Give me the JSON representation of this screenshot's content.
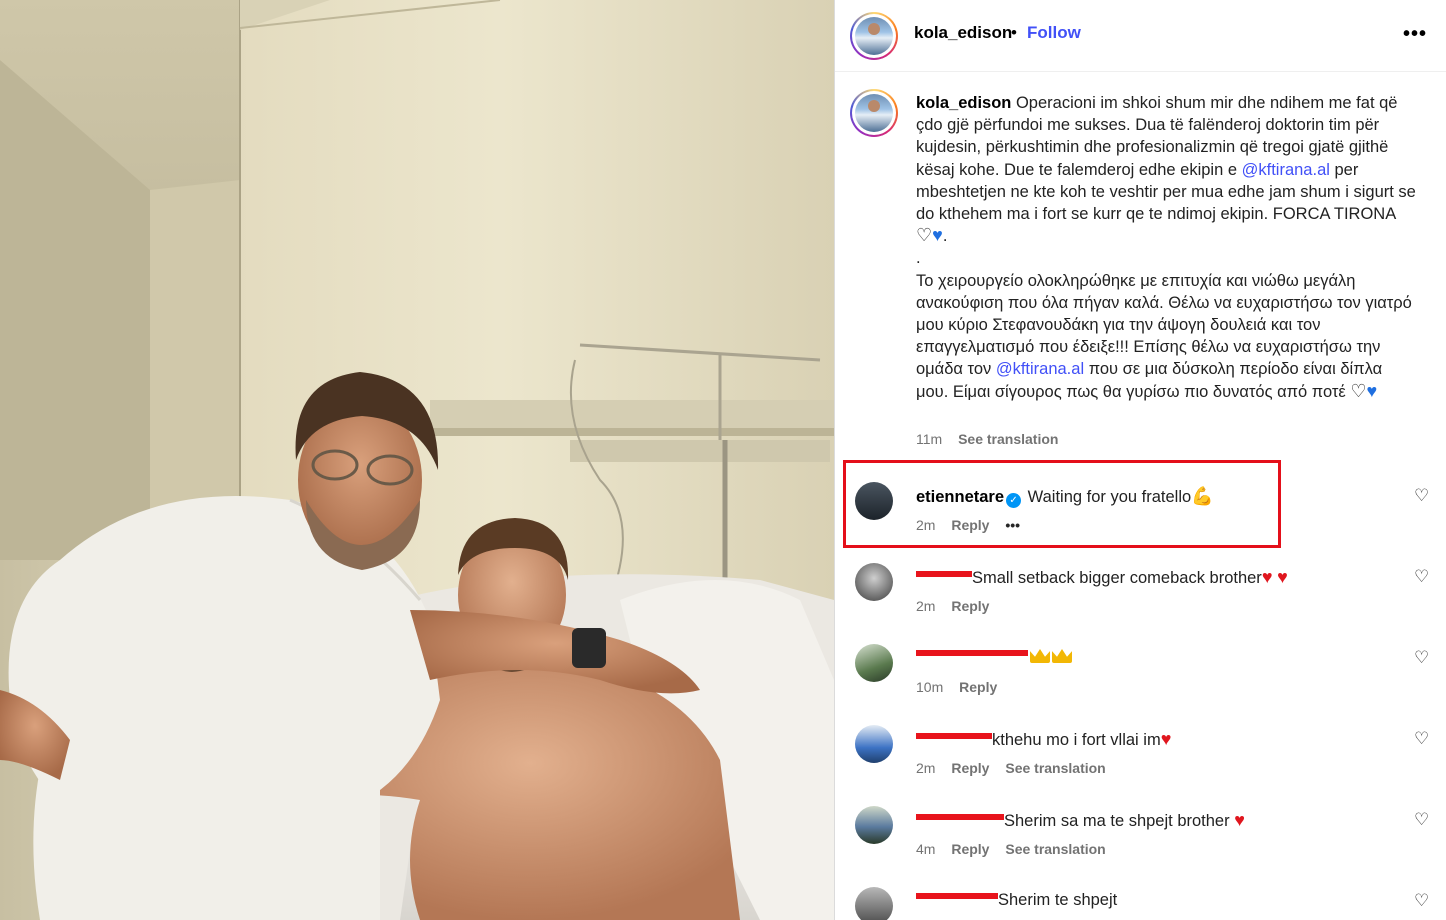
{
  "post": {
    "username": "kola_edison",
    "dot": "•",
    "follow_label": "Follow",
    "more_icon": "more-horizontal-icon",
    "caption": {
      "username": "kola_edison",
      "p1_a": "Operacioni im shkoi shum mir dhe ndihem me fat që çdo gjë përfundoi me sukses. Dua të falënderoj doktorin tim për kujdesin, përkushtimin dhe profesionalizmin që tregoi gjatë gjithë kësaj kohe. Due te falemderoj edhe ekipin e ",
      "mention1": "@kftirana.al",
      "p1_b": " per mbeshtetjen ne kte koh te veshtir per mua edhe jam shum i sigurt se do kthehem ma i fort se kurr qe te ndimoj ekipin. FORCA TIRONA ",
      "p1_end": ".",
      "sep": ".",
      "p2_a": "Το χειρουργείο ολοκληρώθηκε με επιτυχία και νιώθω μεγάλη ανακούφιση που όλα πήγαν καλά. Θέλω να ευχαριστήσω τον γιατρό μου κύριο Στεφανουδάκη για την άψογη δουλειά και τον επαγγελματισμό που έδειξε!!! Επίσης θέλω να ευχαριστήσω την ομάδα τον ",
      "mention2": "@kftirana.al",
      "p2_b": " που σε μια δύσκολη περίοδο είναι δίπλα μου. Είμαι σίγουρος πως θα γυρίσω πιο δυνατός από ποτέ ",
      "heart_white": "♡",
      "heart_blue": "♥",
      "time": "11m",
      "see_translation": "See translation"
    }
  },
  "comments": [
    {
      "username": "etiennetare",
      "verified": true,
      "text": "Waiting for you fratello",
      "time": "2m",
      "reply": "Reply",
      "more": "•••",
      "highlighted": true
    },
    {
      "username_visible": "",
      "text": "Small setback bigger comeback brother",
      "time": "2m",
      "reply": "Reply"
    },
    {
      "username_visible": "",
      "text": "",
      "time": "10m",
      "reply": "Reply"
    },
    {
      "username_visible": "",
      "text": "kthehu mo i fort vllai im",
      "time": "2m",
      "reply": "Reply",
      "see_translation": "See translation"
    },
    {
      "username_visible": "",
      "text": "Sherim sa ma te shpejt brother",
      "time": "4m",
      "reply": "Reply",
      "see_translation": "See translation"
    },
    {
      "username_visible": "",
      "text": "Sherim te shpejt"
    }
  ],
  "colors": {
    "link": "#4150f7",
    "highlight": "#e40f1a",
    "redaction": "#e8141c",
    "meta": "#737373"
  }
}
